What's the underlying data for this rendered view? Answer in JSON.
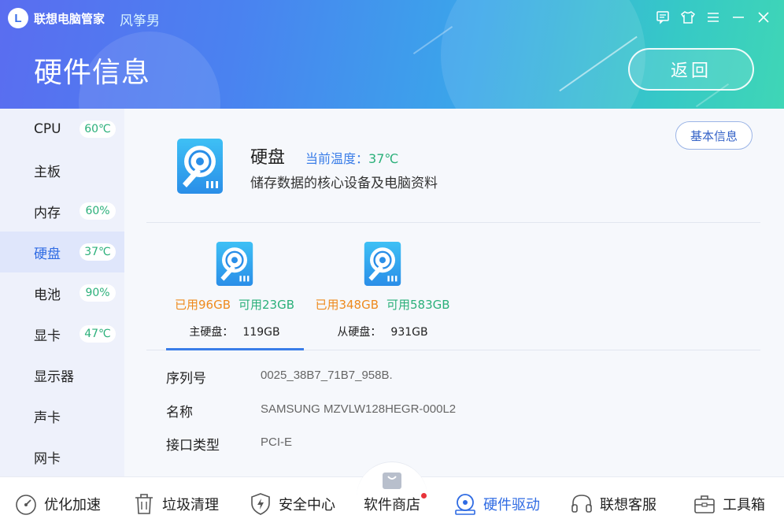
{
  "header": {
    "app_title": "联想电脑管家",
    "user_name": "风筝男",
    "page_title": "硬件信息",
    "back_label": "返回",
    "window_controls": [
      "feedback-icon",
      "skin-icon",
      "menu-icon",
      "minimize-icon",
      "close-icon"
    ]
  },
  "sidebar": {
    "items": [
      {
        "label": "CPU",
        "badge": "60℃"
      },
      {
        "label": "主板",
        "badge": ""
      },
      {
        "label": "内存",
        "badge": "60%"
      },
      {
        "label": "硬盘",
        "badge": "37℃"
      },
      {
        "label": "电池",
        "badge": "90%"
      },
      {
        "label": "显卡",
        "badge": "47℃"
      },
      {
        "label": "显示器",
        "badge": ""
      },
      {
        "label": "声卡",
        "badge": ""
      },
      {
        "label": "网卡",
        "badge": ""
      }
    ],
    "active_index": 3
  },
  "device": {
    "title": "硬盘",
    "temp_label": "当前温度：",
    "temp_value": "37℃",
    "description": "储存数据的核心设备及电脑资料",
    "info_button": "基本信息"
  },
  "disks": [
    {
      "used": "已用96GB",
      "free": "可用23GB",
      "name": "主硬盘：",
      "capacity": "119GB"
    },
    {
      "used": "已用348GB",
      "free": "可用583GB",
      "name": "从硬盘：",
      "capacity": "931GB"
    }
  ],
  "details": [
    {
      "label": "序列号",
      "value": "0025_38B7_71B7_958B."
    },
    {
      "label": "名称",
      "value": "SAMSUNG MZVLW128HEGR-000L2"
    },
    {
      "label": "接口类型",
      "value": "PCI-E"
    }
  ],
  "bottom_nav": [
    {
      "label": "优化加速",
      "icon": "speedometer-icon"
    },
    {
      "label": "垃圾清理",
      "icon": "trash-icon"
    },
    {
      "label": "安全中心",
      "icon": "shield-icon"
    },
    {
      "label": "软件商店",
      "icon": "store-bag-icon"
    },
    {
      "label": "硬件驱动",
      "icon": "hardware-disk-icon"
    },
    {
      "label": "联想客服",
      "icon": "headset-icon"
    },
    {
      "label": "工具箱",
      "icon": "toolbox-icon"
    }
  ],
  "colors": {
    "accent": "#2f6be3",
    "green": "#2bb07a",
    "orange": "#ee8a1d",
    "notify_dot": "#e8333a"
  }
}
